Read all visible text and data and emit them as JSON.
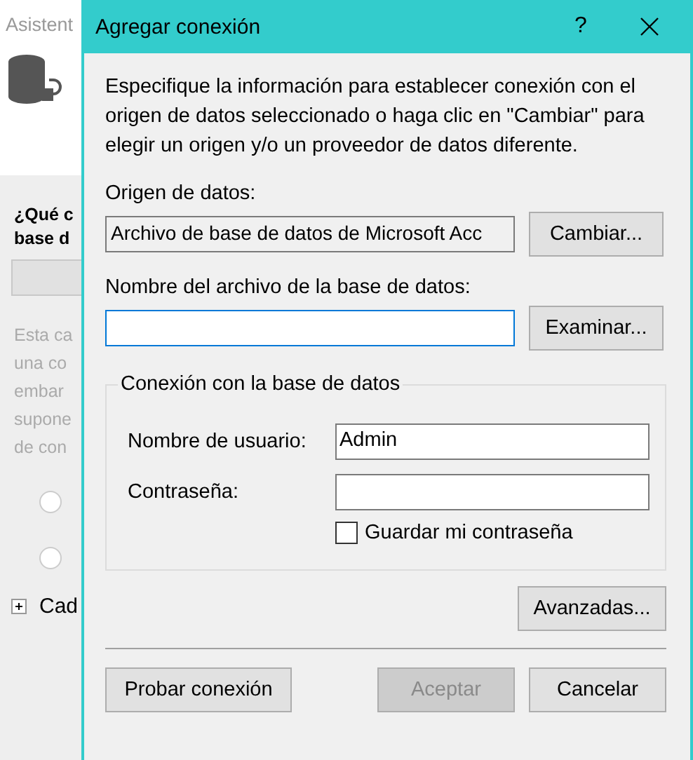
{
  "background_window": {
    "title": "Asistent",
    "heading_lines": [
      "¿Qué c",
      "base d"
    ],
    "description_lines": [
      "Esta ca",
      "una co",
      "embar",
      "supone",
      "de con"
    ],
    "radios": [
      {
        "selected": false
      },
      {
        "selected": false
      }
    ],
    "tree_item": {
      "label": "Cad",
      "expanded": false
    }
  },
  "dialog": {
    "title": "Agregar conexión",
    "help_button": "?",
    "description": "Especifique la información para establecer conexión con el origen de datos seleccionado o haga clic en \"Cambiar\" para elegir un origen y/o un proveedor de datos diferente.",
    "data_source": {
      "label": "Origen de datos:",
      "value": "Archivo de base de datos de Microsoft Acc",
      "button": "Cambiar..."
    },
    "file": {
      "label": "Nombre del archivo de la base de datos:",
      "focused": true,
      "button": "Examinar..."
    },
    "group": {
      "legend": "Conexión con la base de datos",
      "username": {
        "label": "Nombre de usuario:",
        "value": "Admin"
      },
      "password": {
        "label": "Contraseña:"
      },
      "save_password": {
        "label": "Guardar mi contraseña",
        "checked": false
      }
    },
    "advanced_button": "Avanzadas...",
    "buttons": [
      {
        "label": "Probar conexión",
        "disabled": false
      },
      {
        "label": "Aceptar",
        "disabled": true
      },
      {
        "label": "Cancelar",
        "disabled": false
      }
    ]
  }
}
